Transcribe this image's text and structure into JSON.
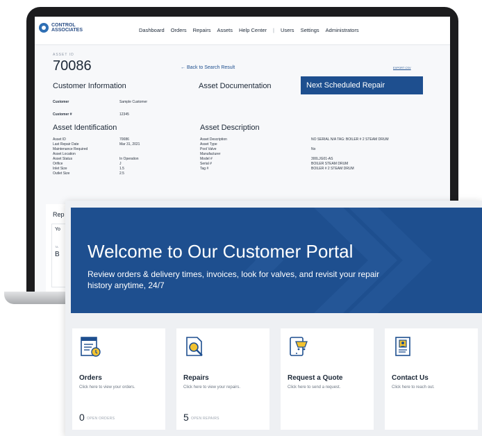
{
  "header": {
    "logo_line1": "CONTROL",
    "logo_line2": "ASSOCIATES",
    "menu": [
      "Dashboard",
      "Orders",
      "Repairs",
      "Assets",
      "Help Center",
      "|",
      "Users",
      "Settings",
      "Administrators"
    ]
  },
  "asset": {
    "label": "ASSET ID",
    "id": "70086",
    "back_link": "← Back to Search Result",
    "export": "EXPORT CSV",
    "customer_info_title": "Customer Information",
    "documentation_title": "Asset Documentation",
    "next_repair": "Next Scheduled Repair",
    "customer_rows": [
      {
        "k": "Customer",
        "v": "Sample Customer"
      },
      {
        "k": "Customer #",
        "v": "12345"
      }
    ],
    "identification_title": "Asset Identification",
    "identification_rows": [
      {
        "k": "Asset ID",
        "v": "70086"
      },
      {
        "k": "Last Repair Date",
        "v": "Mar 31, 2021"
      },
      {
        "k": "Maintenance Required",
        "v": ""
      },
      {
        "k": "Asset Location",
        "v": ""
      },
      {
        "k": "Asset Status",
        "v": "In Operation"
      },
      {
        "k": "Orifice",
        "v": "J"
      },
      {
        "k": "Inlet Size",
        "v": "1.5"
      },
      {
        "k": "Outlet Size",
        "v": "2.5"
      }
    ],
    "description_title": "Asset Description",
    "description_rows": [
      {
        "k": "Asset Description",
        "v": "NO SERIAL N/A TAG: BOILER # 2 STEAM DRUM"
      },
      {
        "k": "Asset Type",
        "v": ""
      },
      {
        "k": "Pool Valve",
        "v": "No"
      },
      {
        "k": "Manufacturer",
        "v": ""
      },
      {
        "k": "Model #",
        "v": "300LJG01-AS"
      },
      {
        "k": "Serial #",
        "v": "BOILER STEAM DRUM"
      },
      {
        "k": "Tag #",
        "v": "BOILER # 2 STEAM DRUM"
      }
    ],
    "repairs_partial_title": "Rep",
    "repairs_partial_line1": "Yo",
    "repairs_partial_line2": "TA",
    "repairs_partial_line3": "B"
  },
  "portal": {
    "title": "Welcome to Our Customer Portal",
    "subtitle": "Review orders & delivery times, invoices, look for valves, and revisit your repair history anytime, 24/7",
    "cards": [
      {
        "title": "Orders",
        "desc": "Click here to view your orders.",
        "count": "0",
        "count_label": "OPEN ORDERS"
      },
      {
        "title": "Repairs",
        "desc": "Click here to view your repairs.",
        "count": "5",
        "count_label": "OPEN REPAIRS"
      },
      {
        "title": "Request a Quote",
        "desc": "Click here to send a request.",
        "count": "",
        "count_label": ""
      },
      {
        "title": "Contact Us",
        "desc": "Click here to reach out.",
        "count": "",
        "count_label": ""
      }
    ]
  },
  "colors": {
    "brand_blue": "#1e4f8f",
    "accent_yellow": "#f2c230"
  }
}
